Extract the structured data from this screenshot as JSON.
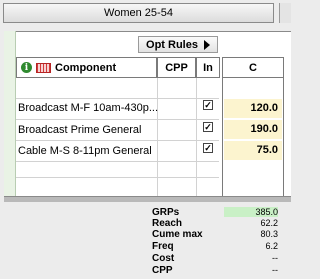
{
  "demographic": {
    "label": "Women 25-54"
  },
  "opt_rules": {
    "label": "Opt Rules"
  },
  "columns": {
    "component": "Component",
    "cpp": "CPP",
    "in": "In",
    "c": "C"
  },
  "rows": [
    {
      "label": "Broadcast M-F 10am-430p...",
      "checked": true,
      "value": "120.0"
    },
    {
      "label": "Broadcast Prime General",
      "checked": true,
      "value": "190.0"
    },
    {
      "label": "Cable M-S 8-11pm General",
      "checked": true,
      "value": "75.0"
    }
  ],
  "summary": [
    {
      "label": "GRPs",
      "value": "385.0",
      "highlight": true
    },
    {
      "label": "Reach",
      "value": "62.2",
      "highlight": false
    },
    {
      "label": "Cume max",
      "value": "80.3",
      "highlight": false
    },
    {
      "label": "Freq",
      "value": "6.2",
      "highlight": false
    },
    {
      "label": "Cost",
      "value": "--",
      "highlight": false
    },
    {
      "label": "CPP",
      "value": "--",
      "highlight": false
    }
  ],
  "icons": {
    "info": "info-icon",
    "film": "film-strip-icon",
    "play": "triangle-right-icon"
  },
  "colors": {
    "value_cell": "#fcf4cf",
    "grps_highlight": "#c9f0c6",
    "info_icon": "#2f8a2f"
  }
}
